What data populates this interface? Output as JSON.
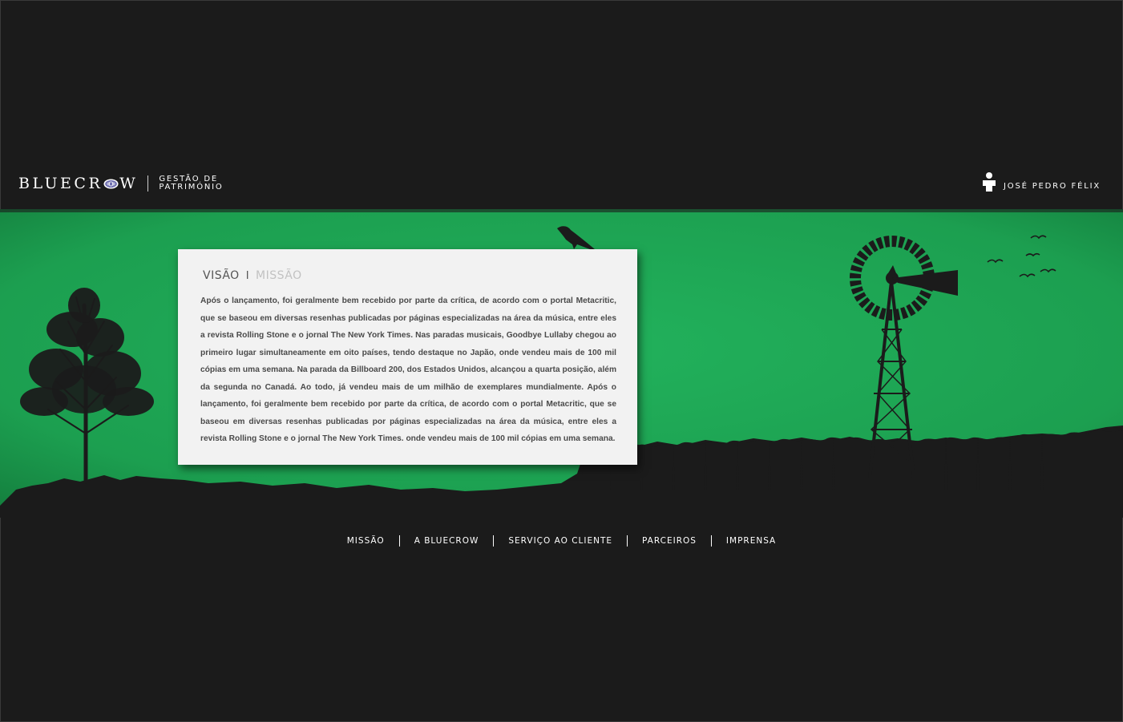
{
  "brand": {
    "logo_prefix": "BLUECR",
    "logo_suffix": "W",
    "tagline_line1": "GESTÃO DE",
    "tagline_line2": "PATRIMÓNIO"
  },
  "user": {
    "name": "JOSÉ PEDRO FÉLIX",
    "icon": "person-icon"
  },
  "card": {
    "tab_active": "VISÃO",
    "tab_separator": "I",
    "tab_inactive": "MISSÃO",
    "text": "Após o lançamento, foi geralmente bem recebido por parte da crítica, de acordo com o portal Metacritic, que se baseou em diversas resenhas publicadas por páginas especializadas na área da música, entre eles a revista Rolling Stone e o jornal The New York Times. Nas paradas musicais, Goodbye Lullaby chegou ao primeiro lugar simultaneamente em oito países, tendo destaque no Japão, onde vendeu mais de 100 mil cópias em uma semana. Na parada da Billboard 200, dos Estados Unidos, alcançou a quarta posição, além da segunda no Canadá. Ao todo, já vendeu mais de um milhão de exemplares mundialmente. Após o lançamento, foi geralmente bem recebido por parte da crítica, de acordo com o portal Metacritic, que se baseou em diversas resenhas publicadas por páginas especializadas na área da música, entre eles a revista Rolling Stone e o jornal The New York Times. onde vendeu mais de 100 mil cópias em uma semana."
  },
  "footer_nav": {
    "items": [
      "MISSÃO",
      "A BLUECROW",
      "SERVIÇO AO CLIENTE",
      "PARCEIROS",
      "IMPRENSA"
    ]
  },
  "colors": {
    "background": "#1b1b1b",
    "scene_green": "#1fa855",
    "card": "#f2f2f2",
    "silhouette": "#1b1b1b"
  }
}
